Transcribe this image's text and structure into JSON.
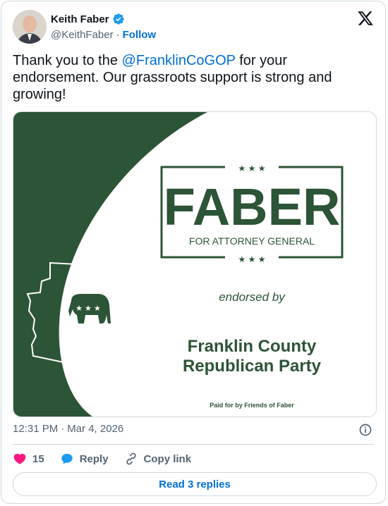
{
  "author": {
    "name": "Keith Faber",
    "handle": "@KeithFaber",
    "separator": "·",
    "follow_label": "Follow"
  },
  "tweet": {
    "text_before": "Thank you to the ",
    "mention": "@FranklinCoGOP",
    "text_after": " for your endorsement. Our grassroots support is strong and growing!"
  },
  "media": {
    "stars": "★  ★  ★",
    "headline": "FABER",
    "subtitle": "FOR ATTORNEY GENERAL",
    "endorsed": "endorsed by",
    "org_line1": "Franklin County",
    "org_line2": "Republican Party",
    "paid_for": "Paid for by Friends of Faber",
    "elephant_stars": "★ ★ ★",
    "colors": {
      "green": "#2c5436",
      "white": "#ffffff"
    }
  },
  "meta": {
    "time": "12:31 PM",
    "separator": "·",
    "date": "Mar 4, 2026"
  },
  "actions": {
    "like_count": "15",
    "reply_label": "Reply",
    "copy_label": "Copy link"
  },
  "read_replies_label": "Read 3 replies",
  "icons": {
    "verified": "verified-badge-icon",
    "x": "x-logo-icon",
    "info": "info-icon",
    "heart": "heart-icon",
    "reply": "reply-bubble-icon",
    "link": "link-icon"
  },
  "colors": {
    "link_blue": "#006fd6",
    "muted": "#536471",
    "heart": "#f91880",
    "verified": "#1d9bf0"
  }
}
